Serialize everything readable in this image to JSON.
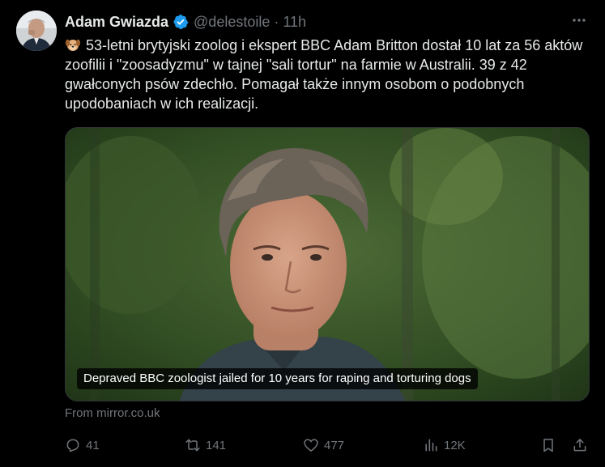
{
  "author": {
    "name": "Adam Gwiazda",
    "handle": "@delestoile",
    "time": "11h"
  },
  "tweet": {
    "emoji": "dog-face-emoji",
    "text": "53-letni brytyjski zoolog i ekspert BBC Adam Britton dostał 10 lat za 56 aktów zoofilii i \"zoosadyzmu\" w tajnej \"sali tortur\" na farmie w Australii. 39 z 42 gwałconych psów zdechło. Pomagał także innym osobom o podobnych upodobaniach w ich realizacji."
  },
  "card": {
    "caption": "Depraved BBC zoologist jailed for 10 years for raping and torturing dogs",
    "source": "From mirror.co.uk"
  },
  "actions": {
    "replies": "41",
    "reposts": "141",
    "likes": "477",
    "views": "12K"
  },
  "colors": {
    "background": "#000000",
    "text": "#e7e9ea",
    "muted": "#71767b",
    "verified": "#1d9bf0"
  }
}
